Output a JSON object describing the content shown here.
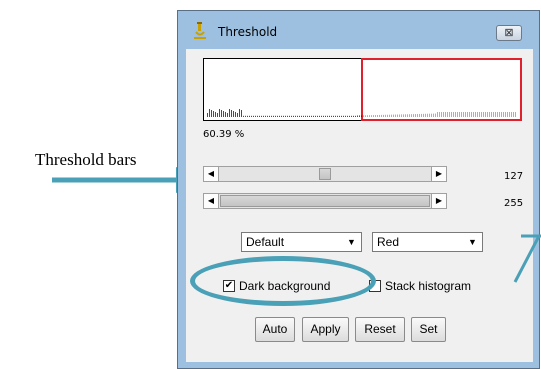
{
  "annotation": {
    "label": "Threshold bars"
  },
  "window": {
    "title": "Threshold",
    "close_glyph": "⊠"
  },
  "stats": {
    "percent": "60.39 %"
  },
  "sliders": [
    {
      "name": "lower-threshold",
      "value": "127",
      "fraction": 0.5
    },
    {
      "name": "upper-threshold",
      "value": "255",
      "fraction": 1.0
    }
  ],
  "dropdowns": {
    "method": {
      "selected": "Default"
    },
    "mode": {
      "selected": "Red"
    }
  },
  "checkboxes": {
    "dark_background": {
      "label": "Dark background",
      "checked": true
    },
    "stack_histogram": {
      "label": "Stack histogram",
      "checked": false
    }
  },
  "buttons": {
    "auto": "Auto",
    "apply": "Apply",
    "reset": "Reset",
    "set": "Set"
  },
  "colors": {
    "window_frame": "#9dc0e0",
    "client": "#f0f0f0",
    "threshold_red": "#e0202a",
    "annotation_teal": "#4aa0b6"
  },
  "icons": {
    "app": "microscope-icon",
    "close": "close-icon",
    "arrow_left": "◀",
    "arrow_right": "▶",
    "dropdown": "▼",
    "check": "✔"
  }
}
